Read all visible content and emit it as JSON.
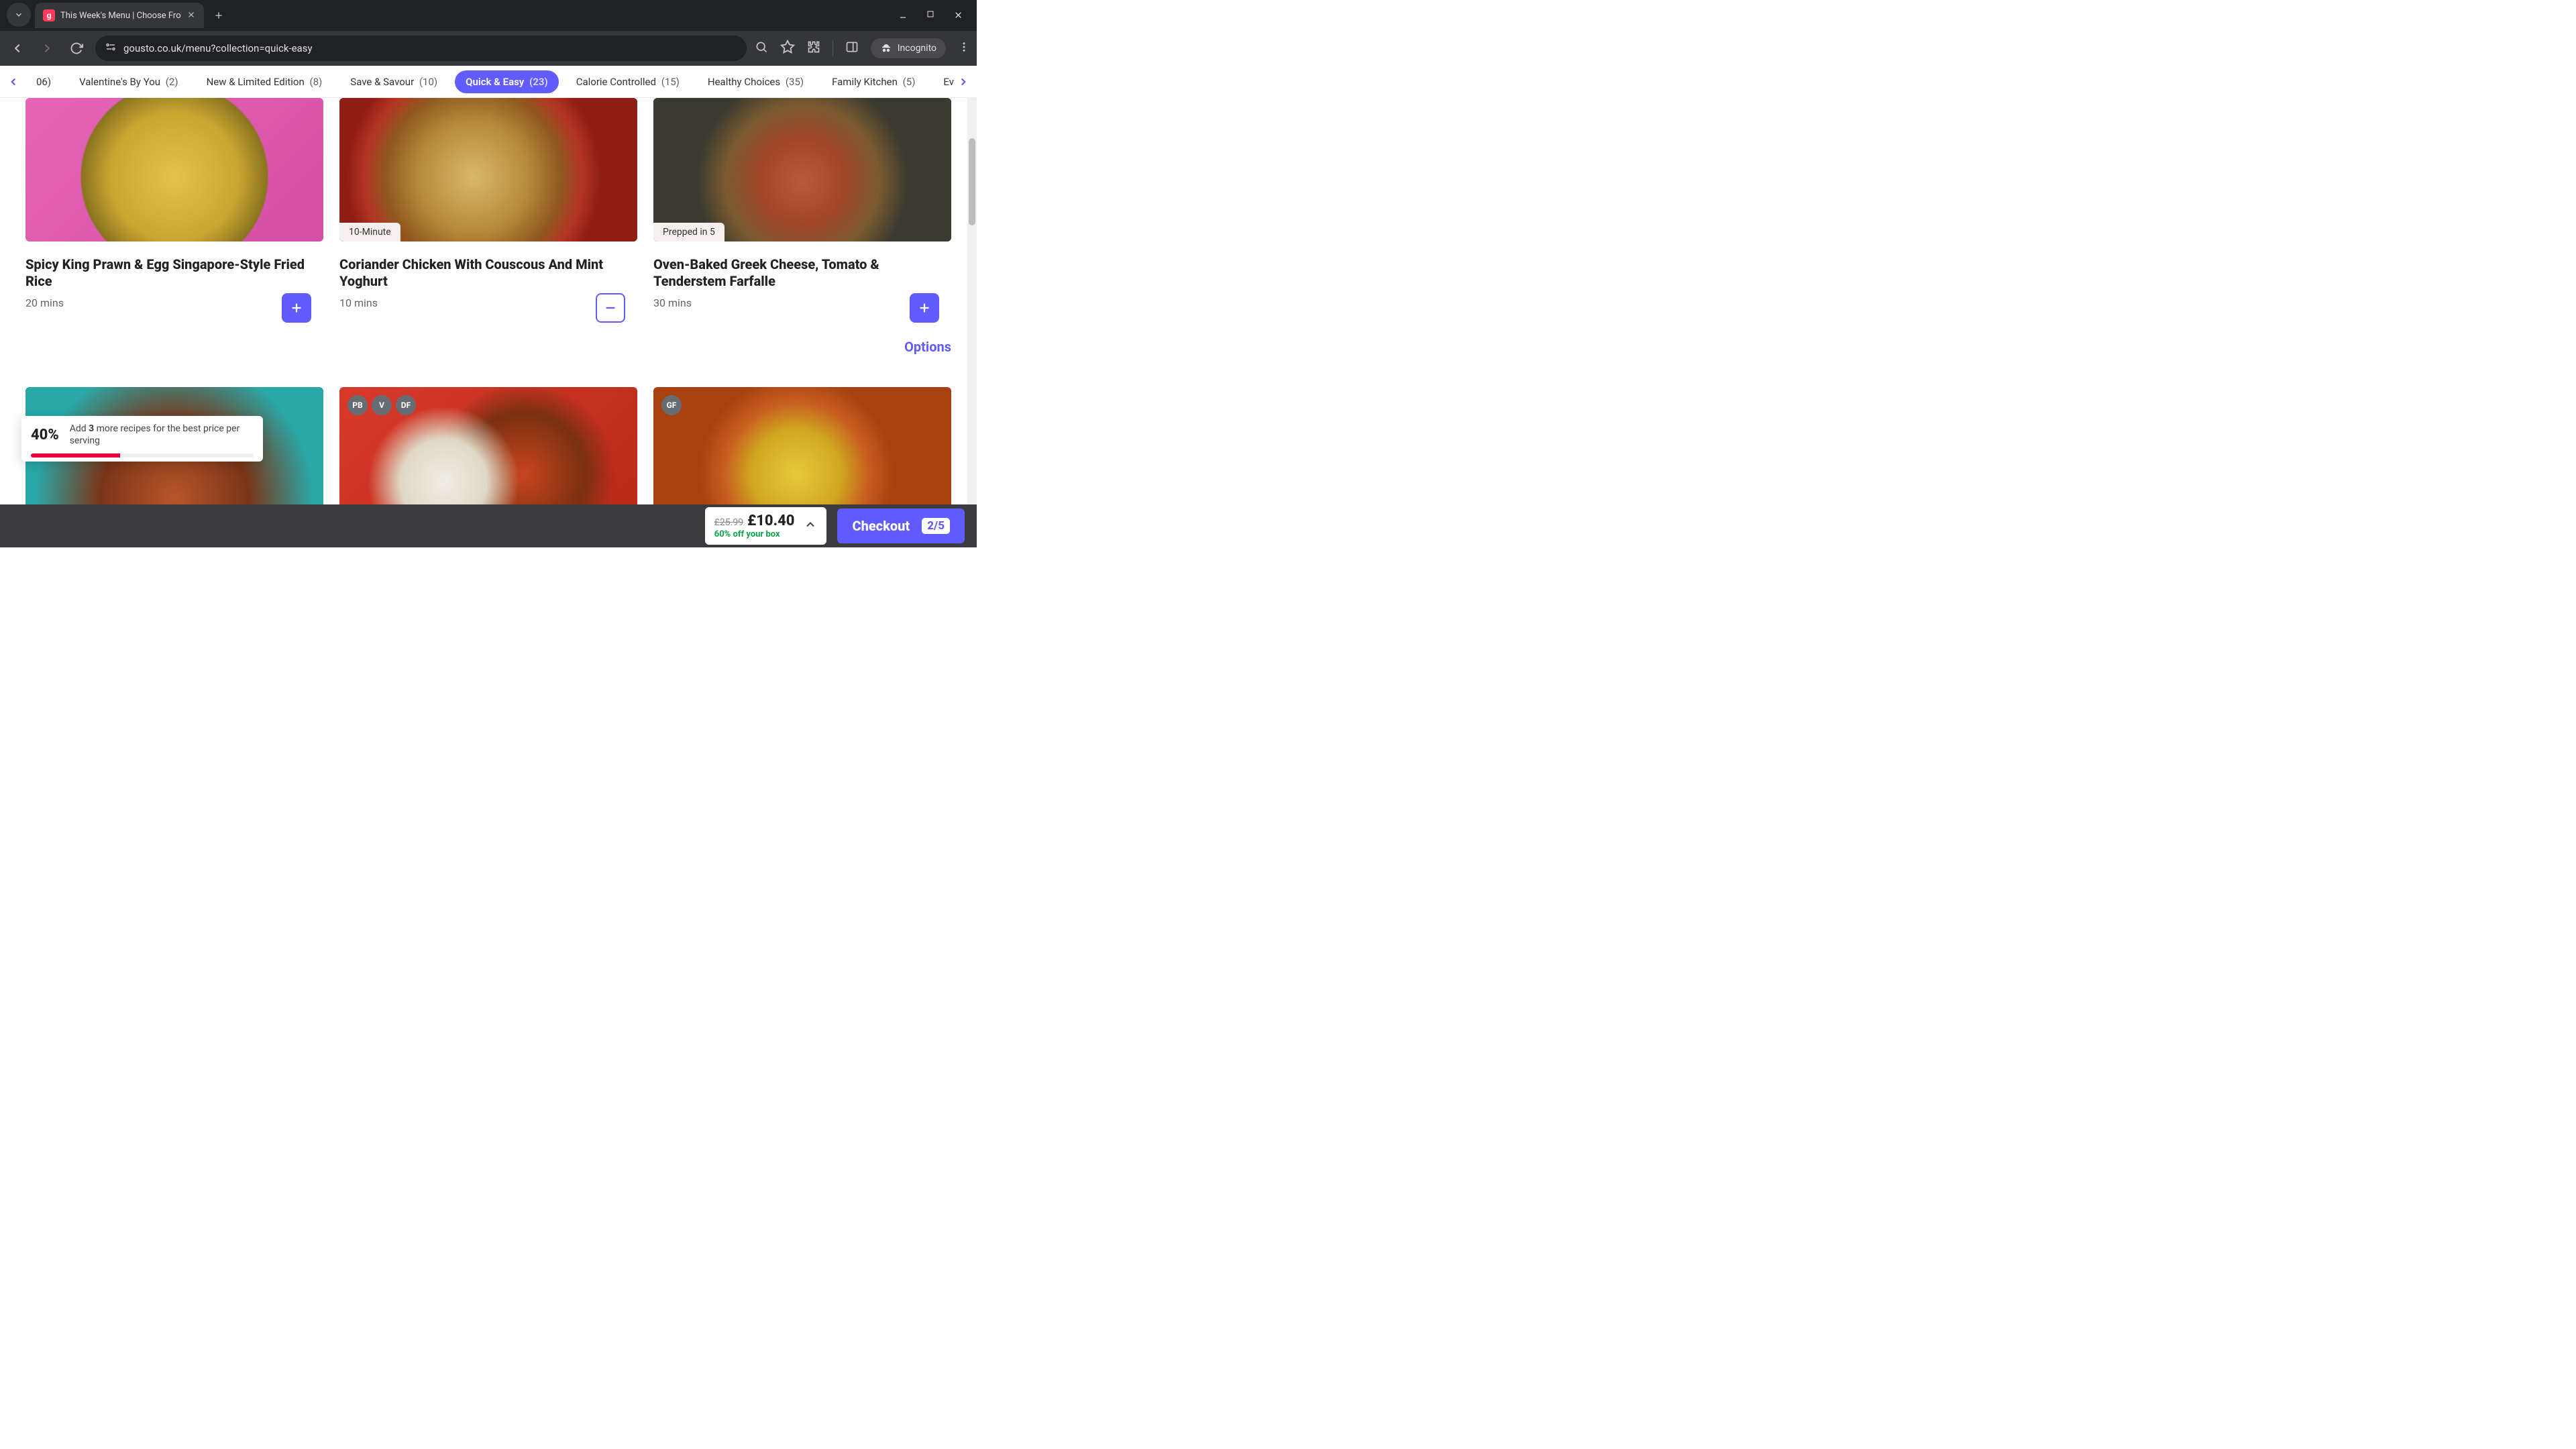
{
  "browser": {
    "tab_title": "This Week's Menu | Choose Fro",
    "url": "gousto.co.uk/menu?collection=quick-easy",
    "incognito_label": "Incognito"
  },
  "categories": {
    "partial_left": "06)",
    "items": [
      {
        "label": "Valentine's By You",
        "count": "(2)",
        "active": false
      },
      {
        "label": "New & Limited Edition",
        "count": "(8)",
        "active": false
      },
      {
        "label": "Save & Savour",
        "count": "(10)",
        "active": false
      },
      {
        "label": "Quick & Easy",
        "count": "(23)",
        "active": true
      },
      {
        "label": "Calorie Controlled",
        "count": "(15)",
        "active": false
      },
      {
        "label": "Healthy Choices",
        "count": "(35)",
        "active": false
      },
      {
        "label": "Family Kitchen",
        "count": "(5)",
        "active": false
      }
    ],
    "partial_right": "Everyd"
  },
  "recipes": [
    {
      "title": "Spicy King Prawn & Egg Singapore-Style Fried Rice",
      "time": "20 mins",
      "tag": "",
      "action": "add",
      "badges": []
    },
    {
      "title": "Coriander Chicken With Couscous And Mint Yoghurt",
      "time": "10 mins",
      "tag": "10-Minute",
      "action": "remove",
      "badges": []
    },
    {
      "title": "Oven-Baked Greek Cheese, Tomato & Tenderstem Farfalle",
      "time": "30 mins",
      "tag": "Prepped in 5",
      "action": "add",
      "badges": []
    },
    {
      "title": "",
      "time": "",
      "tag": "",
      "action": "",
      "badges": []
    },
    {
      "title": "",
      "time": "",
      "tag": "",
      "action": "",
      "badges": [
        "PB",
        "V",
        "DF"
      ]
    },
    {
      "title": "",
      "time": "",
      "tag": "",
      "action": "",
      "badges": [
        "GF"
      ]
    }
  ],
  "options_label": "Options",
  "tooltip": {
    "percent": "40%",
    "prefix": "Add ",
    "bold": "3",
    "suffix": " more recipes for the best price per serving",
    "progress": 40
  },
  "footer": {
    "old_price": "£25.99",
    "new_price": "£10.40",
    "discount": "60% off your box",
    "checkout_label": "Checkout",
    "count": "2/5"
  }
}
